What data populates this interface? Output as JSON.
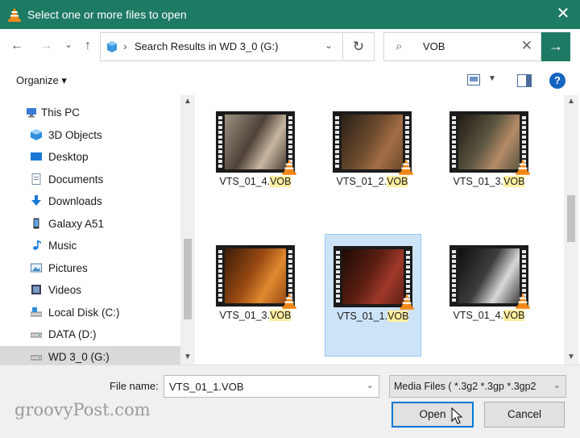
{
  "window": {
    "title": "Select one or more files to open",
    "close_glyph": "✕"
  },
  "nav": {
    "back_glyph": "←",
    "forward_glyph": "→",
    "recent_glyph": "⌄",
    "up_glyph": "↑",
    "address_sep": "›",
    "address_path": "Search Results in WD 3_0 (G:)",
    "address_dd": "⌄",
    "refresh_glyph": "↻",
    "search_icon": "⌕",
    "search_value": "VOB",
    "search_clear": "✕",
    "go_glyph": "→"
  },
  "commands": {
    "organize": "Organize ▾",
    "view_dd": "▼",
    "help": "?"
  },
  "sidebar": [
    {
      "label": "This PC",
      "icon": "pc-icon",
      "indent": 0
    },
    {
      "label": "3D Objects",
      "icon": "cube-icon",
      "indent": 1
    },
    {
      "label": "Desktop",
      "icon": "desktop-icon",
      "indent": 1
    },
    {
      "label": "Documents",
      "icon": "documents-icon",
      "indent": 1
    },
    {
      "label": "Downloads",
      "icon": "downloads-icon",
      "indent": 1
    },
    {
      "label": "Galaxy A51",
      "icon": "phone-icon",
      "indent": 1
    },
    {
      "label": "Music",
      "icon": "music-icon",
      "indent": 1
    },
    {
      "label": "Pictures",
      "icon": "pictures-icon",
      "indent": 1
    },
    {
      "label": "Videos",
      "icon": "videos-icon",
      "indent": 1
    },
    {
      "label": "Local Disk (C:)",
      "icon": "local-disk-icon",
      "indent": 1
    },
    {
      "label": "DATA (D:)",
      "icon": "drive-icon",
      "indent": 1
    },
    {
      "label": "WD 3_0 (G:)",
      "icon": "drive-icon",
      "indent": 1,
      "selected": true
    }
  ],
  "files": [
    {
      "stem": "VTS_01_4.",
      "ext": "VOB",
      "frame": [
        "#9c9182",
        "#4e4238",
        "#c8b6a0"
      ]
    },
    {
      "stem": "VTS_01_2.",
      "ext": "VOB",
      "frame": [
        "#2a2018",
        "#6b4a2c",
        "#a36d45"
      ]
    },
    {
      "stem": "VTS_01_3.",
      "ext": "VOB",
      "frame": [
        "#201a14",
        "#5d5641",
        "#b58b66"
      ]
    },
    {
      "stem": "VTS_01_3.",
      "ext": "VOB",
      "frame": [
        "#3a1b08",
        "#9a4a12",
        "#e08a30"
      ]
    },
    {
      "stem": "VTS_01_1.",
      "ext": "VOB",
      "frame": [
        "#1d0a06",
        "#5e1f12",
        "#a0392a"
      ],
      "selected": true
    },
    {
      "stem": "VTS_01_4.",
      "ext": "VOB",
      "frame": [
        "#0e0e0e",
        "#3d3d3d",
        "#d9d9d9"
      ]
    }
  ],
  "footer": {
    "file_name_label": "File name:",
    "file_name_value": "VTS_01_1.VOB",
    "dd_glyph": "⌄",
    "filter_value": "Media Files ( *.3g2 *.3gp *.3gp2",
    "open_label": "Open",
    "cancel_label": "Cancel"
  },
  "watermark": "groovyPost.com",
  "scroll_arrows": {
    "up": "▲",
    "down": "▼"
  },
  "colors": {
    "titlebar": "#1d7a63",
    "selection": "#cde3f8",
    "highlight": "#ffeea0",
    "accent": "#0078d7"
  }
}
